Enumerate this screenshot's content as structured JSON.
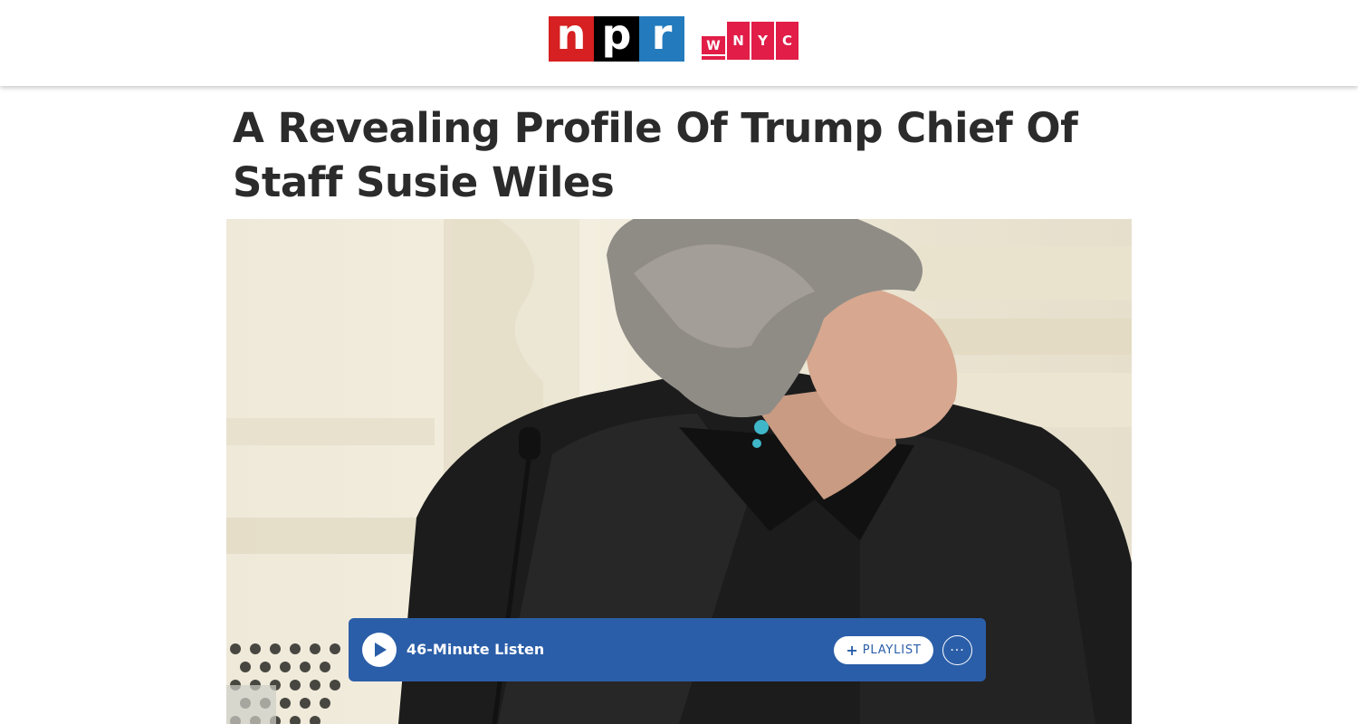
{
  "header": {
    "npr_logo": {
      "letters": [
        "n",
        "p",
        "r"
      ],
      "colors": [
        "#d62021",
        "#000000",
        "#237bbd"
      ]
    },
    "station_logo": {
      "letters": [
        "W",
        "N",
        "Y",
        "C"
      ],
      "color": "#e11d48"
    }
  },
  "article": {
    "headline": "A Revealing Profile Of Trump Chief Of Staff Susie Wiles"
  },
  "audio_player": {
    "play_icon": "play-icon",
    "duration_label": "46-Minute Listen",
    "playlist_button": {
      "icon": "+",
      "label": "PLAYLIST"
    },
    "more_button": {
      "icon": "···"
    },
    "accent_color": "#2b5ea8"
  }
}
